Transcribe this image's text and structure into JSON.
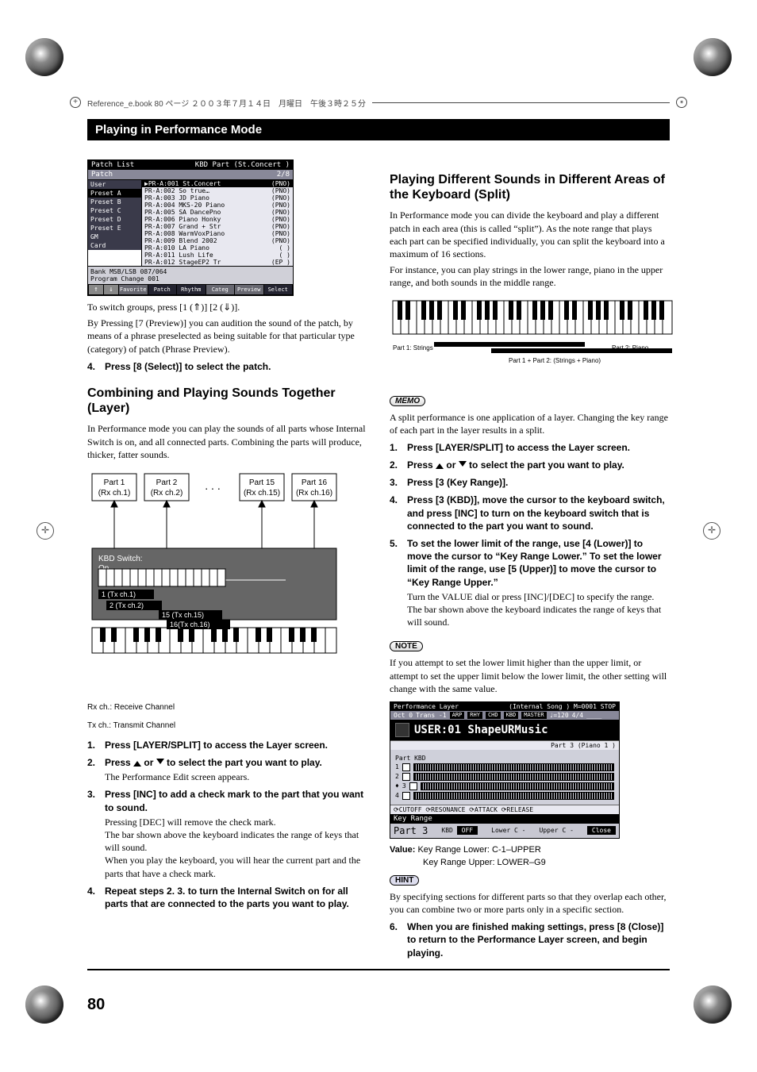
{
  "header": {
    "text": "Reference_e.book 80 ページ ２００３年７月１４日　月曜日　午後３時２５分"
  },
  "sectionTitle": "Playing in Performance Mode",
  "patchList": {
    "titleLeft": "Patch List",
    "titleRight": "KBD Part   (St.Concert   )",
    "tabLabel": "Patch",
    "pageBadge": "2/8",
    "sideTabs": [
      "User",
      "Preset A",
      "Preset B",
      "Preset C",
      "Preset D",
      "Preset E",
      "GM",
      "Card"
    ],
    "rows": [
      {
        "id": "PR-A:001",
        "name": "St.Concert",
        "tag": "(PNO)"
      },
      {
        "id": "PR-A:002",
        "name": "So true…",
        "tag": "(PNO)"
      },
      {
        "id": "PR-A:003",
        "name": "JD Piano",
        "tag": "(PNO)"
      },
      {
        "id": "PR-A:004",
        "name": "MKS-20 Piano",
        "tag": "(PNO)"
      },
      {
        "id": "PR-A:005",
        "name": "SA DancePno",
        "tag": "(PNO)"
      },
      {
        "id": "PR-A:006",
        "name": "Piano Honky",
        "tag": "(PNO)"
      },
      {
        "id": "PR-A:007",
        "name": "Grand + Str",
        "tag": "(PNO)"
      },
      {
        "id": "PR-A:008",
        "name": "WarmVoxPiano",
        "tag": "(PNO)"
      },
      {
        "id": "PR-A:009",
        "name": "Blend 2002",
        "tag": "(PNO)"
      },
      {
        "id": "PR-A:010",
        "name": "LA Piano",
        "tag": "( )"
      },
      {
        "id": "PR-A:011",
        "name": "Lush Life",
        "tag": "( )"
      },
      {
        "id": "PR-A:012",
        "name": "StageEP2 Tr",
        "tag": "(EP )"
      }
    ],
    "footer1": "Bank MSB/LSB    087/064",
    "footer2": "Program Change 001",
    "buttons": [
      "↑",
      "↓",
      "Favorite",
      "Patch",
      "Rhythm",
      "Categ",
      "Preview",
      "Select"
    ]
  },
  "col1": {
    "afterList": "To switch groups, press [1 (⇑)] [2 (⇓)].",
    "preview": "By Pressing [7 (Preview)] you can audition the sound of the patch, by means of a phrase preselected as being suitable for that particular type (category) of patch (Phrase Preview).",
    "step4": "Press [8 (Select)] to select the patch.",
    "layerHeading": "Combining and Playing Sounds Together (Layer)",
    "layerIntro": "In Performance mode you can play the sounds of all parts whose Internal Switch is on, and all connected parts. Combining the parts will produce, thicker, fatter sounds.",
    "diagram": {
      "parts": [
        {
          "name": "Part 1",
          "rx": "(Rx ch.1)"
        },
        {
          "name": "Part 2",
          "rx": "(Rx ch.2)"
        },
        {
          "name": "Part 15",
          "rx": "(Rx ch.15)"
        },
        {
          "name": "Part 16",
          "rx": "(Rx ch.16)"
        }
      ],
      "kbdLabel": "KBD Switch:\nOn",
      "dots": ". . .",
      "tx": [
        "1 (Tx ch.1)",
        "2 (Tx ch.2)",
        "15 (Tx ch.15)",
        "16(Tx ch.16)"
      ],
      "captionRx": "Rx ch.: Receive Channel",
      "captionTx": "Tx ch.: Transmit Channel"
    },
    "steps": [
      {
        "n": "1.",
        "bold": "Press [LAYER/SPLIT] to access the Layer screen."
      },
      {
        "n": "2.",
        "bold": "Press  ▲  or  ▼  to select the part you want to play.",
        "plain": "The Performance Edit screen appears."
      },
      {
        "n": "3.",
        "bold": "Press [INC] to add a check mark to the part that you want to sound.",
        "plain": "Pressing [DEC] will remove the check mark.\nThe bar shown above the keyboard indicates the range of keys that will sound.\nWhen you play the keyboard, you will hear the current part and the parts that have a check mark."
      },
      {
        "n": "4.",
        "bold": "Repeat steps 2. 3. to turn the Internal Switch on for all parts that are connected to the parts you want to play."
      }
    ]
  },
  "col2": {
    "heading": "Playing Different Sounds in Different Areas of the Keyboard (Split)",
    "intro1": "In Performance mode you can divide the keyboard and play a different patch in each area (this is called “split”). As the note range that plays each part can be specified individually, you can split the keyboard into a maximum of 16 sections.",
    "intro2": "For instance, you can play strings in the lower range, piano in the upper range, and both sounds in the middle range.",
    "splitDiagram": {
      "left": "Part 1: Strings",
      "mid": "Part 1 + Part 2:\n(Strings + Piano)",
      "right": "Part 2: Piano"
    },
    "memoBadge": "MEMO",
    "memoText": "A split performance is one application of a layer. Changing the key range of each part in the layer results in a split.",
    "steps": [
      {
        "n": "1.",
        "bold": "Press [LAYER/SPLIT] to access the Layer screen."
      },
      {
        "n": "2.",
        "bold": "Press  ▲  or  ▼  to select the part you want to play."
      },
      {
        "n": "3.",
        "bold": "Press [3 (Key Range)]."
      },
      {
        "n": "4.",
        "bold": "Press [3 (KBD)], move the cursor to the keyboard switch, and press [INC] to turn on the keyboard switch that is connected to the part you want to sound."
      },
      {
        "n": "5.",
        "bold": "To set the lower limit of the range, use [4 (Lower)] to move the cursor to “Key Range Lower.” To set the lower limit of the range, use [5 (Upper)] to move the cursor to “Key Range Upper.”",
        "plain": "Turn the VALUE dial or press [INC]/[DEC] to specify the range. The bar shown above the keyboard indicates the range of keys that will sound."
      }
    ],
    "noteBadge": "NOTE",
    "noteText": "If you attempt to set the lower limit higher than the upper limit, or attempt to set the upper limit below the lower limit, the other setting will change with the same value.",
    "perfScreen": {
      "t1Left": "Performance Layer",
      "t1Right": "(Internal Song  ) M=0001   STOP",
      "t2": [
        "Oct 0",
        "Trans -1",
        "ARP",
        "RHY",
        "CHD",
        "KBD",
        "MASTER",
        "♩=120",
        "4/4",
        "____"
      ],
      "big": "USER:01 ShapeURMusic",
      "subPart": "Part  3   (Piano 1         )",
      "rows": [
        "1",
        "2",
        "3",
        "4"
      ],
      "knobs": "⟳CUTOFF   ⟳RESONANCE   ⟳ATTACK   ⟳RELEASE",
      "keyRange": "Key Range",
      "partLabel": "Part 3",
      "kbd": "KBD",
      "kbdVal": "OFF",
      "lower": "Lower",
      "lowerVal": "C -",
      "upper": "Upper",
      "upperVal": "C -",
      "close": "Close"
    },
    "valueLabel": "Value:",
    "value1": "Key Range Lower: C-1–UPPER",
    "value2": "Key Range Upper: LOWER–G9",
    "hintBadge": "HINT",
    "hintText": "By specifying sections for different parts so that they overlap each other, you can combine two or more parts only in a specific section.",
    "step6": {
      "n": "6.",
      "bold": "When you are finished making settings, press [8 (Close)] to return to the Performance Layer screen, and begin playing."
    }
  },
  "pageNumber": "80"
}
